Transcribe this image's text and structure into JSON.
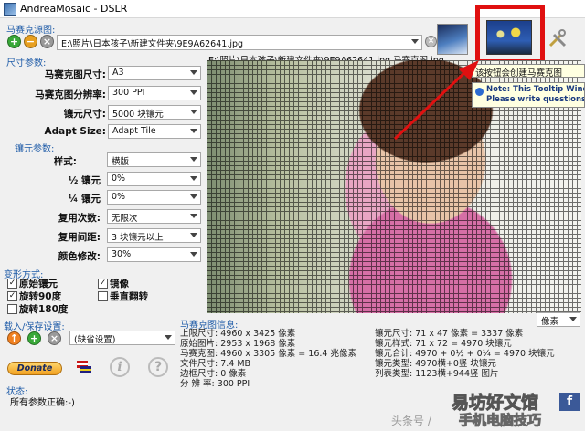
{
  "window": {
    "title": "AndreaMosaic - DSLR"
  },
  "source": {
    "heading": "马赛克源图:",
    "path": "E:\\照片\\日本孩子\\新建文件夹\\9E9A62641.jpg",
    "preview_path": "E:\\照片\\日本孩子\\新建文件夹\\9E9A62641.jpg 马赛克图.jpg"
  },
  "tooltip": {
    "text": "该按钮会创建马赛克图",
    "note_line1": "Note: This Tooltip Window",
    "note_line2": "Please write questions/"
  },
  "size_params": {
    "heading": "尺寸参数:",
    "rows": [
      {
        "label": "马赛克图尺寸:",
        "value": "A3"
      },
      {
        "label": "马赛克图分辨率:",
        "value": "300 PPI"
      },
      {
        "label": "镶元尺寸:",
        "value": "5000 块镶元"
      },
      {
        "label": "Adapt Size:",
        "value": "Adapt Tile"
      }
    ]
  },
  "tile_params": {
    "heading": "镶元参数:",
    "rows": [
      {
        "label": "样式:",
        "value": "横版"
      },
      {
        "label": "½ 镶元",
        "value": "0%"
      },
      {
        "label": "¼ 镶元",
        "value": "0%"
      },
      {
        "label": "复用次数:",
        "value": "无限次"
      },
      {
        "label": "复用间距:",
        "value": "3 块镶元以上"
      },
      {
        "label": "颜色修改:",
        "value": "30%"
      }
    ]
  },
  "transform": {
    "heading": "变形方式:",
    "items": [
      {
        "label": "原始镶元",
        "checked": true
      },
      {
        "label": "镜像",
        "checked": true
      },
      {
        "label": "旋转90度",
        "checked": true
      },
      {
        "label": "垂直翻转",
        "checked": false
      },
      {
        "label": "旋转180度",
        "checked": false
      }
    ]
  },
  "load_save": {
    "heading": "载入/保存设置:",
    "value": "(缺省设置)"
  },
  "donate": {
    "label": "Donate"
  },
  "status": {
    "heading": "状态:",
    "text": "所有参数正确:-)"
  },
  "unit_select": {
    "value": "像素"
  },
  "mosaic_info": {
    "heading": "马赛克图信息:",
    "left": [
      {
        "label": "上限尺寸:",
        "value": "4960 x 3425 像素"
      },
      {
        "label": "原始图片:",
        "value": "2953 x 1968 像素"
      },
      {
        "label": "马赛克图:",
        "value": "4960 x 3305 像素 = 16.4 兆像素"
      },
      {
        "label": "文件尺寸:",
        "value": "7.4 MB"
      },
      {
        "label": "边框尺寸:",
        "value": "0 像素"
      },
      {
        "label": "分 辨 率:",
        "value": "300 PPI"
      }
    ],
    "right": [
      {
        "label": "镶元尺寸:",
        "value": "71 x 47 像素 = 3337 像素"
      },
      {
        "label": "镶元样式:",
        "value": "71 x 72 = 4970 块镶元"
      },
      {
        "label": "镶元合计:",
        "value": "4970 + 0½ + 0¼ = 4970 块镶元"
      },
      {
        "label": "镶元类型:",
        "value": "4970横+0竖 块镶元"
      },
      {
        "label": "列表类型:",
        "value": "1123横+944竖 图片"
      }
    ]
  },
  "watermark": {
    "line1": "头条号 /",
    "line2": "易坊好文馆",
    "line3": "手机电脑技巧"
  },
  "colors": {
    "accent": "#1f5ca8",
    "highlight": "#e01010",
    "arrow": "#e01010"
  }
}
